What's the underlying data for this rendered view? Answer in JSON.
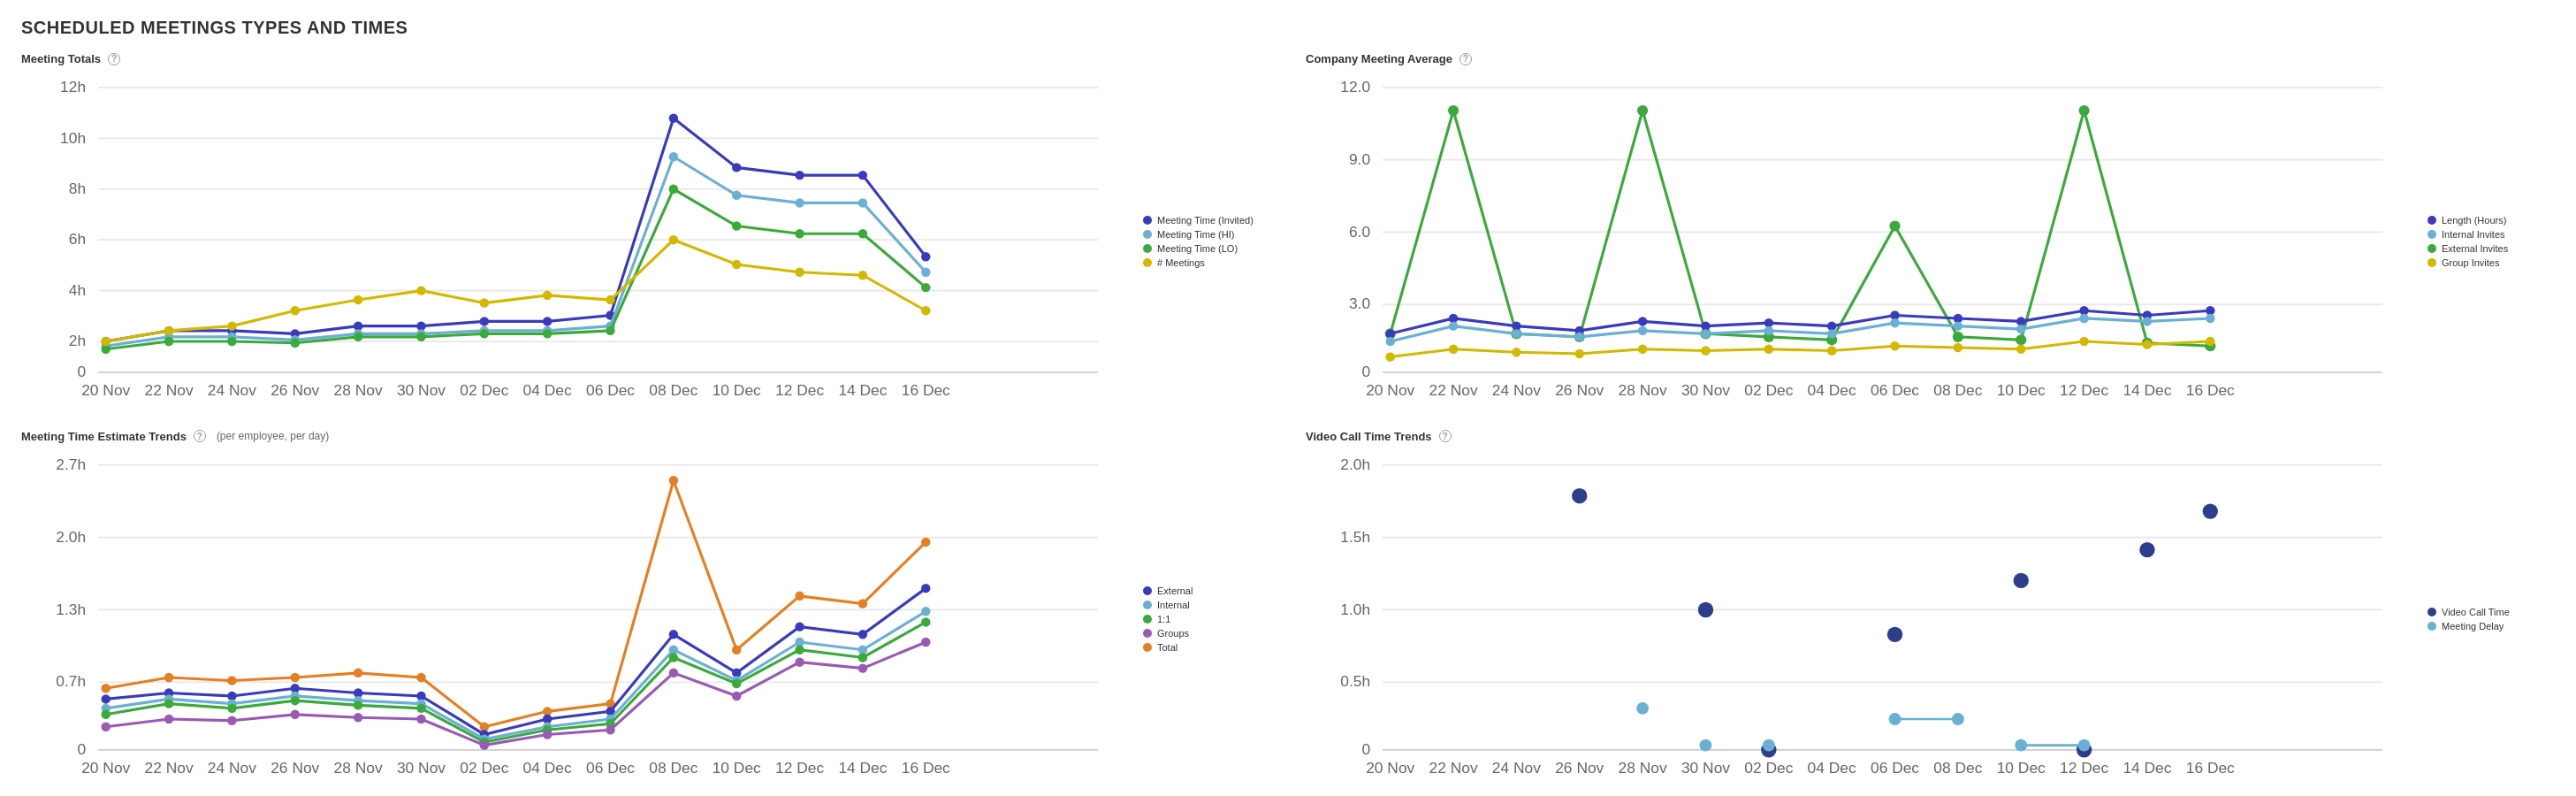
{
  "page": {
    "title": "SCHEDULED MEETINGS TYPES AND TIMES"
  },
  "charts": {
    "meetingTotals": {
      "title": "Meeting Totals",
      "yLabels": [
        "0",
        "2h",
        "4h",
        "6h",
        "8h",
        "10h",
        "12h"
      ],
      "xLabels": [
        "20 Nov",
        "22 Nov",
        "24 Nov",
        "26 Nov",
        "28 Nov",
        "30 Nov",
        "02 Dec",
        "04 Dec",
        "06 Dec",
        "08 Dec",
        "10 Dec",
        "12 Dec",
        "14 Dec",
        "16 Dec"
      ],
      "legend": [
        {
          "label": "Meeting Time (Invited)",
          "color": "#3a3abf"
        },
        {
          "label": "Meeting Time (HI)",
          "color": "#6ab0d4"
        },
        {
          "label": "Meeting Time (LO)",
          "color": "#3aaa3a"
        },
        {
          "label": "# Meetings",
          "color": "#d4b800"
        }
      ]
    },
    "companyAverage": {
      "title": "Company Meeting Average",
      "yLabels": [
        "0",
        "3.0",
        "6.0",
        "9.0",
        "12.0"
      ],
      "xLabels": [
        "20 Nov",
        "22 Nov",
        "24 Nov",
        "26 Nov",
        "28 Nov",
        "30 Nov",
        "02 Dec",
        "04 Dec",
        "06 Dec",
        "08 Dec",
        "10 Dec",
        "12 Dec",
        "14 Dec",
        "16 Dec"
      ],
      "legend": [
        {
          "label": "Length (Hours)",
          "color": "#3a3abf"
        },
        {
          "label": "Internal Invites",
          "color": "#6ab0d4"
        },
        {
          "label": "External Invites",
          "color": "#3aaa3a"
        },
        {
          "label": "Group Invites",
          "color": "#d4b800"
        }
      ]
    },
    "meetingTrends": {
      "title": "Meeting Time Estimate Trends",
      "subheader": "(per employee, per day)",
      "yLabels": [
        "0",
        "0.7h",
        "1.3h",
        "2.0h",
        "2.7h"
      ],
      "xLabels": [
        "20 Nov",
        "22 Nov",
        "24 Nov",
        "26 Nov",
        "28 Nov",
        "30 Nov",
        "02 Dec",
        "04 Dec",
        "06 Dec",
        "08 Dec",
        "10 Dec",
        "12 Dec",
        "14 Dec",
        "16 Dec"
      ],
      "legend": [
        {
          "label": "External",
          "color": "#3a3abf"
        },
        {
          "label": "Internal",
          "color": "#6ab0d4"
        },
        {
          "label": "1:1",
          "color": "#3aaa3a"
        },
        {
          "label": "Groups",
          "color": "#9b59b6"
        },
        {
          "label": "Total",
          "color": "#e67e22"
        }
      ]
    },
    "videoCallTrends": {
      "title": "Video Call Time Trends",
      "yLabels": [
        "0",
        "0.5h",
        "1.0h",
        "1.5h",
        "2.0h"
      ],
      "xLabels": [
        "20 Nov",
        "22 Nov",
        "24 Nov",
        "26 Nov",
        "28 Nov",
        "30 Nov",
        "02 Dec",
        "04 Dec",
        "06 Dec",
        "08 Dec",
        "10 Dec",
        "12 Dec",
        "14 Dec",
        "16 Dec"
      ],
      "legend": [
        {
          "label": "Video Call Time",
          "color": "#2c3e8c"
        },
        {
          "label": "Meeting Delay",
          "color": "#6ab0d4"
        }
      ]
    }
  }
}
